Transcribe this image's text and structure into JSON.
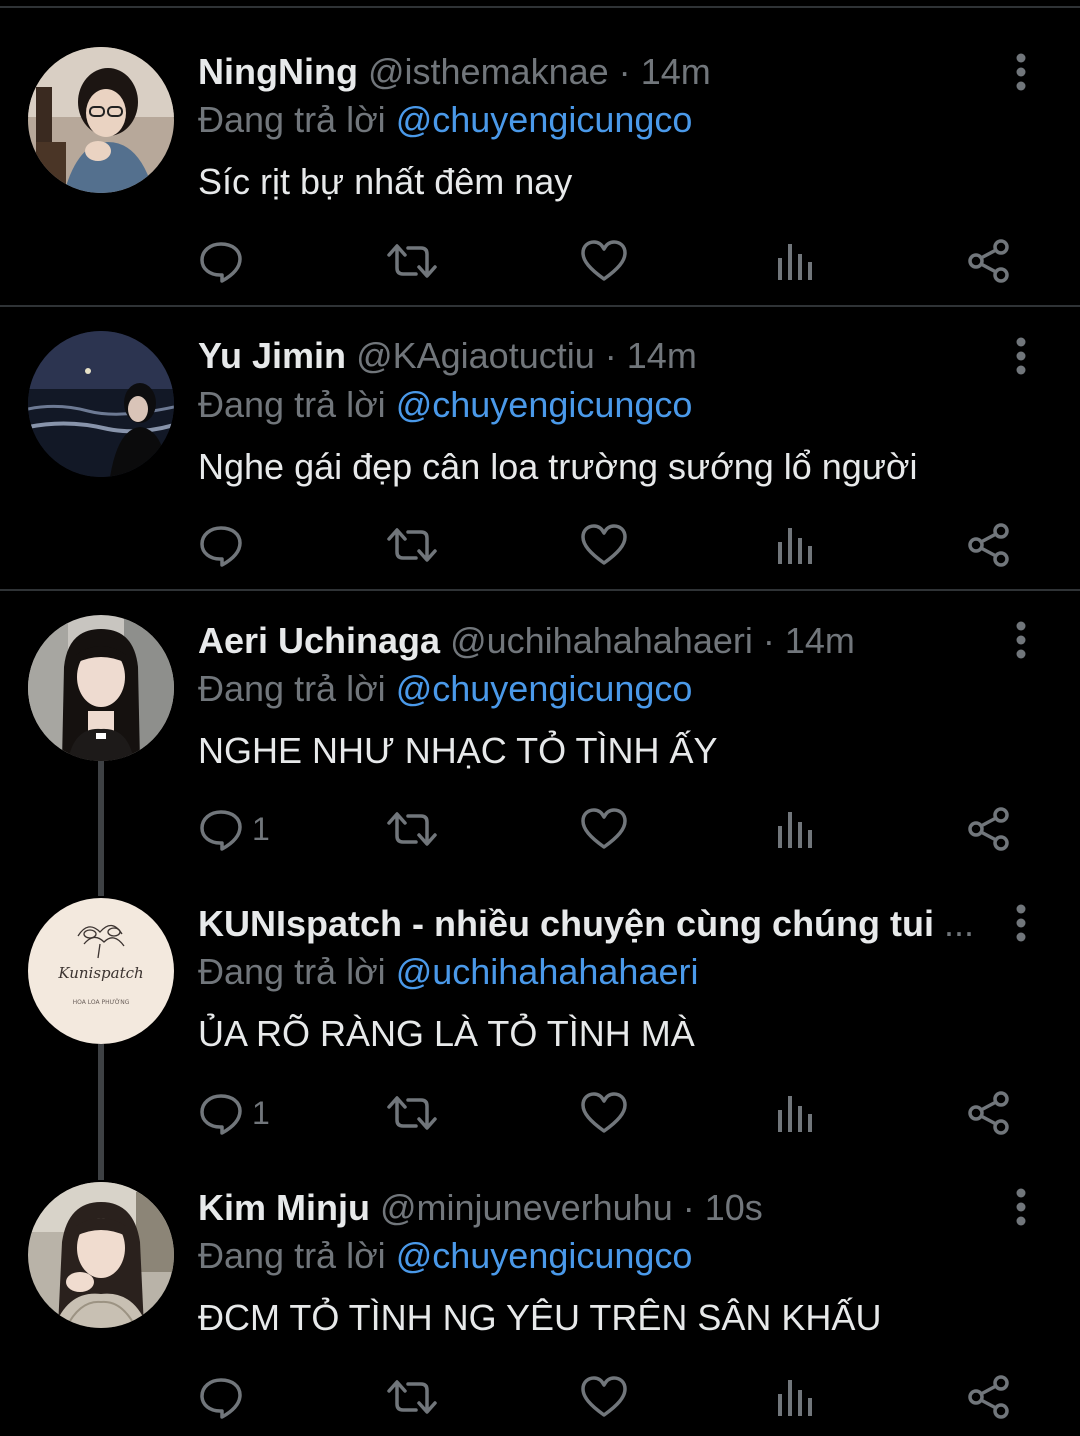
{
  "colors": {
    "background": "#000000",
    "text": "#e7e9ea",
    "muted": "#71767b",
    "link": "#4a99e9",
    "divider": "#2f3336"
  },
  "reply_prefix": "Đang trả lời",
  "tweets": [
    {
      "name": "NingNing",
      "handle": "@isthemaknae",
      "time": "14m",
      "reply_to": "@chuyengicungco",
      "text": "Síc rịt bự nhất đêm nay",
      "reply_count": "",
      "avatar": "woman-with-glasses-photo"
    },
    {
      "name": "Yu Jimin",
      "handle": "@KAgiaotuctiu",
      "time": "14m",
      "reply_to": "@chuyengicungco",
      "text": "Nghe gái đẹp cân loa trường sướng lổ người",
      "reply_count": "",
      "avatar": "woman-at-night-beach-photo"
    },
    {
      "name": "Aeri Uchinaga",
      "handle": "@uchihahahahaeri",
      "time": "14m",
      "reply_to": "@chuyengicungco",
      "text": "NGHE NHƯ NHẠC TỎ TÌNH ẤY",
      "reply_count": "1",
      "avatar": "woman-long-hair-photo"
    },
    {
      "name": "KUNIspatch - nhiều chuyện cùng chúng tui",
      "truncation": "...",
      "handle": "",
      "time": "",
      "reply_to": "@uchihahahahaeri",
      "text": "ỦA RÕ RÀNG LÀ TỎ TÌNH MÀ",
      "reply_count": "1",
      "avatar": "kunispatch-logo",
      "logo_text": "Kunispatch",
      "logo_subtext": "HOA LOA PHƯỜNG"
    },
    {
      "name": "Kim Minju",
      "handle": "@minjuneverhuhu",
      "time": "10s",
      "reply_to": "@chuyengicungco",
      "text": "ĐCM TỎ TÌNH NG YÊU TRÊN SÂN KHẤU",
      "reply_count": "",
      "avatar": "woman-portrait-photo"
    }
  ],
  "icons": {
    "reply": "reply-icon",
    "retweet": "retweet-icon",
    "like": "heart-icon",
    "views": "views-icon",
    "share": "share-icon",
    "more": "more-vertical-icon"
  }
}
